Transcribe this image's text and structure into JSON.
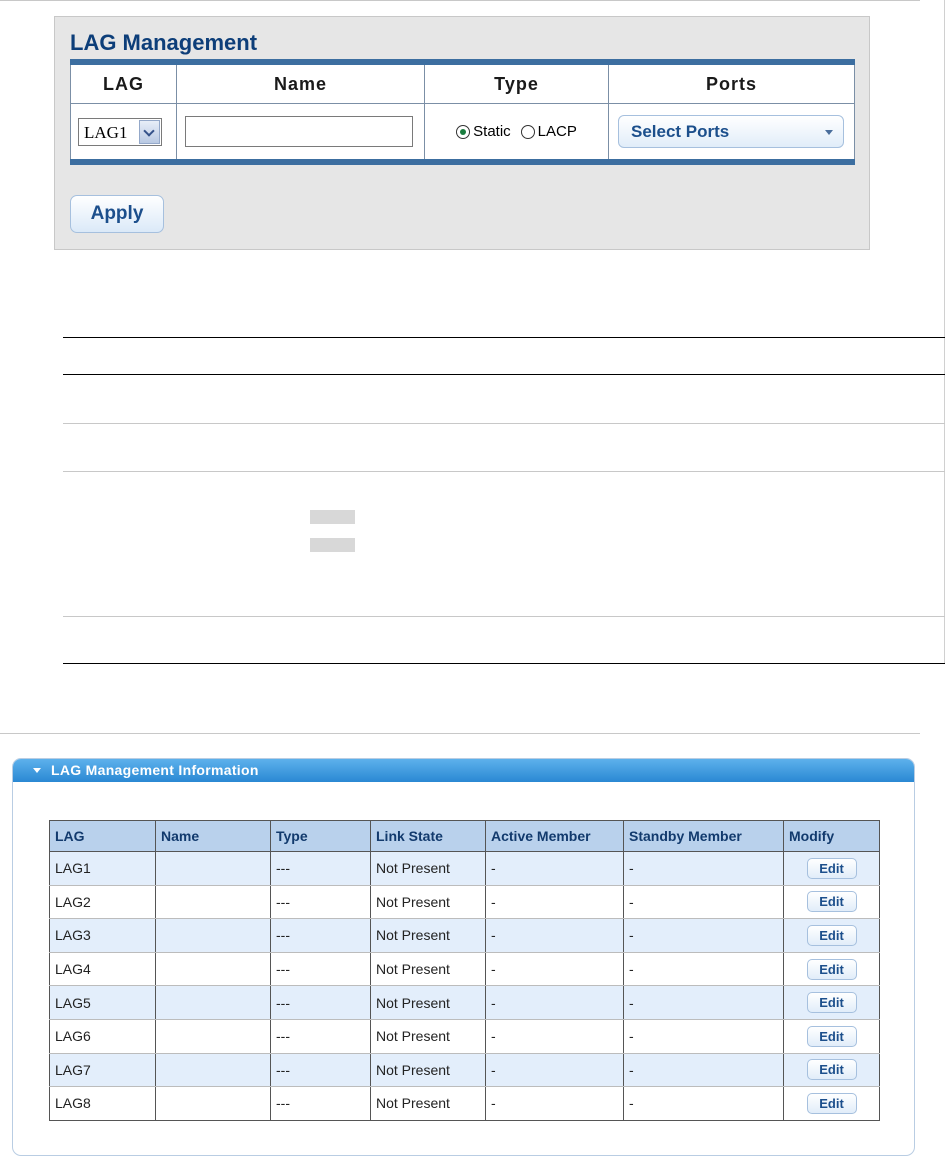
{
  "form": {
    "title": "LAG Management",
    "columns": [
      "LAG",
      "Name",
      "Type",
      "Ports"
    ],
    "lag_select": {
      "value": "LAG1"
    },
    "name_input": {
      "value": ""
    },
    "type": {
      "options": [
        "Static",
        "LACP"
      ],
      "selected": "Static"
    },
    "ports": {
      "label": "Select Ports"
    },
    "apply_label": "Apply"
  },
  "info": {
    "title": "LAG Management Information",
    "columns": [
      "LAG",
      "Name",
      "Type",
      "Link State",
      "Active Member",
      "Standby Member",
      "Modify"
    ],
    "rows": [
      {
        "lag": "LAG1",
        "name": "",
        "type": "---",
        "link_state": "Not Present",
        "active": "-",
        "standby": "-",
        "action": "Edit"
      },
      {
        "lag": "LAG2",
        "name": "",
        "type": "---",
        "link_state": "Not Present",
        "active": "-",
        "standby": "-",
        "action": "Edit"
      },
      {
        "lag": "LAG3",
        "name": "",
        "type": "---",
        "link_state": "Not Present",
        "active": "-",
        "standby": "-",
        "action": "Edit"
      },
      {
        "lag": "LAG4",
        "name": "",
        "type": "---",
        "link_state": "Not Present",
        "active": "-",
        "standby": "-",
        "action": "Edit"
      },
      {
        "lag": "LAG5",
        "name": "",
        "type": "---",
        "link_state": "Not Present",
        "active": "-",
        "standby": "-",
        "action": "Edit"
      },
      {
        "lag": "LAG6",
        "name": "",
        "type": "---",
        "link_state": "Not Present",
        "active": "-",
        "standby": "-",
        "action": "Edit"
      },
      {
        "lag": "LAG7",
        "name": "",
        "type": "---",
        "link_state": "Not Present",
        "active": "-",
        "standby": "-",
        "action": "Edit"
      },
      {
        "lag": "LAG8",
        "name": "",
        "type": "---",
        "link_state": "Not Present",
        "active": "-",
        "standby": "-",
        "action": "Edit"
      }
    ]
  },
  "colors": {
    "title": "#0d3e79",
    "table_border": "#3c6ea0",
    "header_bar": "#2a88d3",
    "row_alt": "#e3eefb",
    "button_text": "#1c4f8c"
  }
}
